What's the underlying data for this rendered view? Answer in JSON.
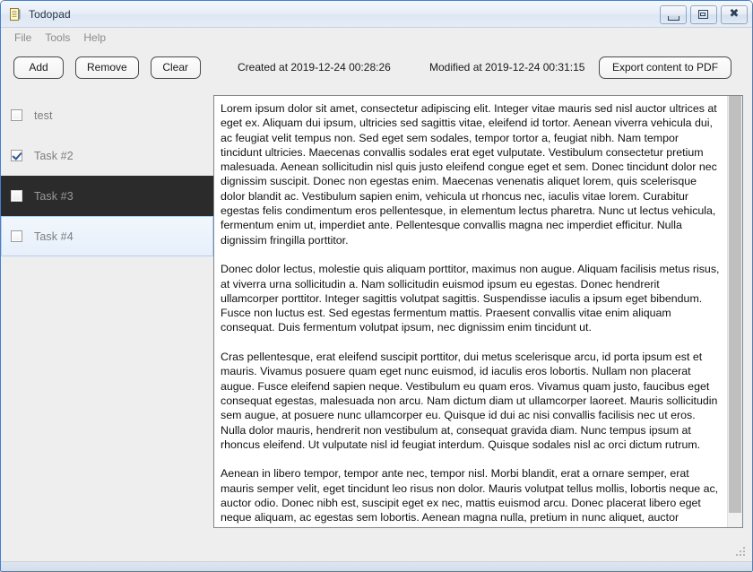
{
  "window": {
    "title": "Todopad",
    "icon": "notepad-icon",
    "controls": {
      "minimize": "Minimize",
      "maximize": "Maximize",
      "close": "Close"
    }
  },
  "menubar": {
    "items": [
      {
        "label": "File",
        "name": "menu-file"
      },
      {
        "label": "Tools",
        "name": "menu-tools"
      },
      {
        "label": "Help",
        "name": "menu-help"
      }
    ]
  },
  "toolbar": {
    "add_label": "Add",
    "remove_label": "Remove",
    "clear_label": "Clear",
    "created_label": "Created at 2019-12-24 00:28:26",
    "modified_label": "Modified at 2019-12-24 00:31:15",
    "export_label": "Export content to PDF"
  },
  "tasks": [
    {
      "label": "test",
      "checked": false,
      "state": "normal"
    },
    {
      "label": "Task #2",
      "checked": true,
      "state": "normal"
    },
    {
      "label": "Task #3",
      "checked": false,
      "state": "selected"
    },
    {
      "label": "Task #4",
      "checked": false,
      "state": "hovered"
    }
  ],
  "editor": {
    "paragraphs": [
      "Lorem ipsum dolor sit amet, consectetur adipiscing elit. Integer vitae mauris sed nisl auctor ultrices at eget ex. Aliquam dui ipsum, ultricies sed sagittis vitae, eleifend id tortor. Aenean viverra vehicula dui, ac feugiat velit tempus non. Sed eget sem sodales, tempor tortor a, feugiat nibh. Nam tempor tincidunt ultricies. Maecenas convallis sodales erat eget vulputate. Vestibulum consectetur pretium malesuada. Aenean sollicitudin nisl quis justo eleifend congue eget et sem. Donec tincidunt dolor nec dignissim suscipit. Donec non egestas enim. Maecenas venenatis aliquet lorem, quis scelerisque dolor blandit ac. Vestibulum sapien enim, vehicula ut rhoncus nec, iaculis vitae lorem. Curabitur egestas felis condimentum eros pellentesque, in elementum lectus pharetra. Nunc ut lectus vehicula, fermentum enim ut, imperdiet ante. Pellentesque convallis magna nec imperdiet efficitur. Nulla dignissim fringilla porttitor.",
      "Donec dolor lectus, molestie quis aliquam porttitor, maximus non augue. Aliquam facilisis metus risus, at viverra urna sollicitudin a. Nam sollicitudin euismod ipsum eu egestas. Donec hendrerit ullamcorper porttitor. Integer sagittis volutpat sagittis. Suspendisse iaculis a ipsum eget bibendum. Fusce non luctus est. Sed egestas fermentum mattis. Praesent convallis vitae enim aliquam consequat. Duis fermentum volutpat ipsum, nec dignissim enim tincidunt ut.",
      "Cras pellentesque, erat eleifend suscipit porttitor, dui metus scelerisque arcu, id porta ipsum est et mauris. Vivamus posuere quam eget nunc euismod, id iaculis eros lobortis. Nullam non placerat augue. Fusce eleifend sapien neque. Vestibulum eu quam eros. Vivamus quam justo, faucibus eget consequat egestas, malesuada non arcu. Nam dictum diam ut ullamcorper laoreet. Mauris sollicitudin sem augue, at posuere nunc ullamcorper eu. Quisque id dui ac nisi convallis facilisis nec ut eros. Nulla dolor mauris, hendrerit non vestibulum at, consequat gravida diam. Nunc tempus ipsum at rhoncus eleifend. Ut vulputate nisl id feugiat interdum. Quisque sodales nisl ac orci dictum rutrum.",
      "Aenean in libero tempor, tempor ante nec, tempor nisl. Morbi blandit, erat a ornare semper, erat mauris semper velit, eget tincidunt leo risus non dolor. Mauris volutpat tellus mollis, lobortis neque ac, auctor odio. Donec nibh est, suscipit eget ex nec, mattis euismod arcu. Donec placerat libero eget neque aliquam, ac egestas sem lobortis. Aenean magna nulla, pretium in nunc aliquet, auctor molestie purus. Nam ante sem, dapibus vel suscipit venenatis, accumsan vitae dui. Nunc pulvinar lectus lacus, placerat convallis ex porttitor sed. Integer laoreet vestibulum interdum. Curabitur nunc"
    ]
  },
  "colors": {
    "accent": "#2b5797",
    "selection_bg": "#2b2b2b",
    "hover_bg": "#e6effb",
    "chrome_bg": "#eeeeee"
  }
}
